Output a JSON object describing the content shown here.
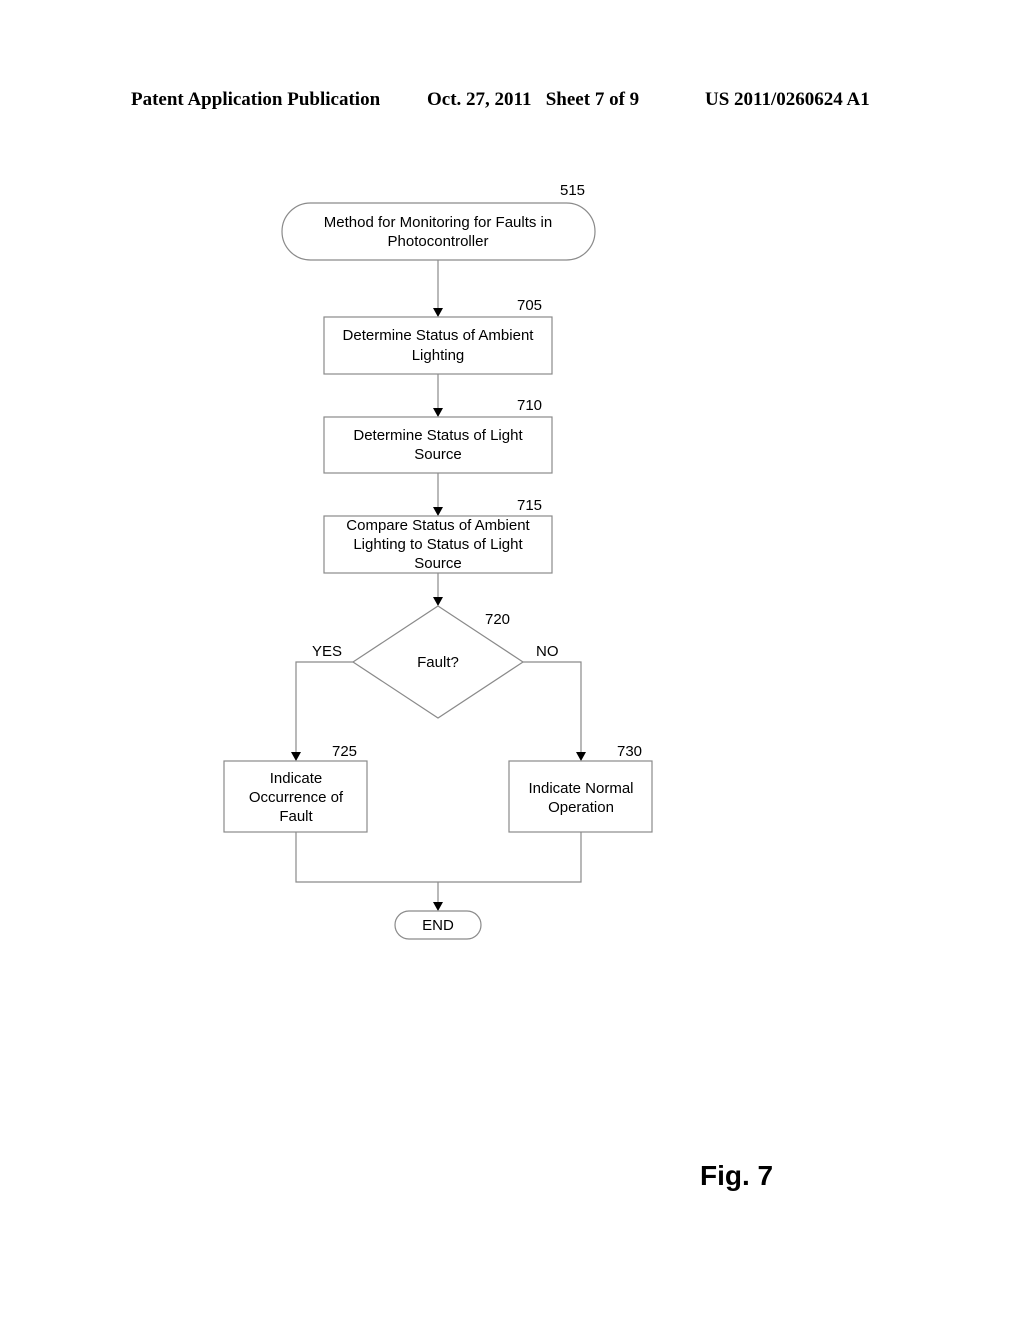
{
  "header": {
    "publication": "Patent Application Publication",
    "date_sheet": "Oct. 27, 2011   Sheet 7 of 9",
    "number": "US 2011/0260624 A1"
  },
  "flowchart": {
    "start": {
      "ref": "515",
      "lines": [
        "Method for Monitoring for Faults in",
        "Photocontroller"
      ]
    },
    "steps": [
      {
        "ref": "705",
        "lines": [
          "Determine Status of Ambient",
          "Lighting"
        ]
      },
      {
        "ref": "710",
        "lines": [
          "Determine Status of Light",
          "Source"
        ]
      },
      {
        "ref": "715",
        "lines": [
          "Compare Status of Ambient",
          "Lighting to Status of Light",
          "Source"
        ]
      }
    ],
    "decision": {
      "ref": "720",
      "label": "Fault?",
      "yes_label": "YES",
      "no_label": "NO"
    },
    "yes_step": {
      "ref": "725",
      "lines": [
        "Indicate",
        "Occurrence of",
        "Fault"
      ]
    },
    "no_step": {
      "ref": "730",
      "lines": [
        "Indicate Normal",
        "Operation"
      ]
    },
    "end": {
      "label": "END"
    }
  },
  "figure_label": "Fig. 7"
}
